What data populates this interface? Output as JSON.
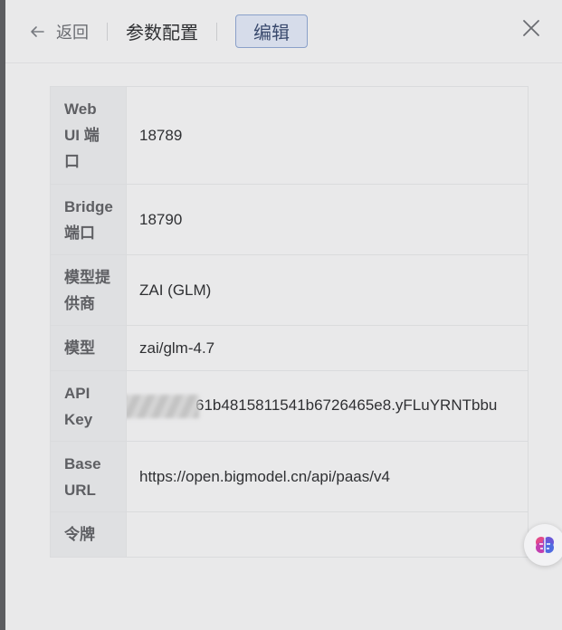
{
  "header": {
    "back_label": "返回",
    "title": "参数配置",
    "edit_label": "编辑"
  },
  "params": [
    {
      "label": "Web UI 端口",
      "value": "18789"
    },
    {
      "label": "Bridge 端口",
      "value": "18790"
    },
    {
      "label": "模型提供商",
      "value": "ZAI (GLM)"
    },
    {
      "label": "模型",
      "value": "zai/glm-4.7"
    },
    {
      "label": "API Key",
      "value": "61b4815811541b6726465e8.yFLuYRNTbbu"
    },
    {
      "label": "Base URL",
      "value": "https://open.bigmodel.cn/api/paas/v4"
    },
    {
      "label": "令牌",
      "value": ""
    }
  ],
  "icons": {
    "back": "arrow-left-icon",
    "close": "close-icon",
    "assistant": "brain-icon"
  },
  "colors": {
    "accent_border": "#8aa0c9",
    "accent_bg": "#d6dcea"
  }
}
